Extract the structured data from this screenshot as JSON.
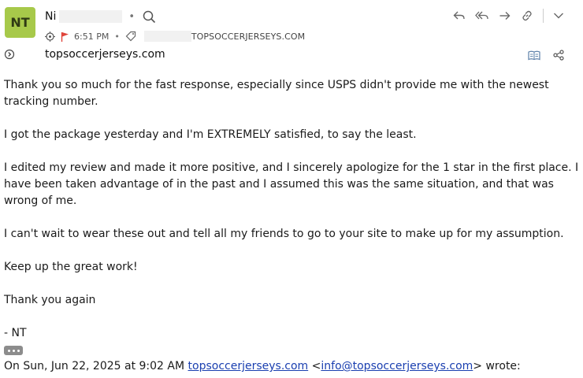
{
  "sender": {
    "initials": "NT",
    "name": "Ni",
    "time": "6:51 PM",
    "domain_label": "TOPSOCCERJERSEYS.COM"
  },
  "subject": "topsoccerjerseys.com",
  "body": {
    "paragraphs": [
      "Thank you so much for the fast response, especially since USPS didn't provide me with the newest tracking number.",
      "I got the package yesterday and I'm EXTREMELY satisfied, to say the least.",
      "I edited my review and made it more positive, and I sincerely apologize for the 1 star in the first place. I have been taken advantage of in the past and I assumed this was the same situation, and that was wrong of me.",
      "I can't wait to wear these out and tell all my friends to go to your site to make up for my assumption.",
      "Keep up the great work!",
      "Thank you again",
      "- NT"
    ],
    "quote": {
      "prefix": "On Sun, Jun 22, 2025 at 9:02 AM ",
      "sender_link": "topsoccerjerseys.com",
      "open": " <",
      "email_link": "info@topsoccerjerseys.com",
      "suffix": "> wrote:"
    }
  },
  "colors": {
    "avatar": "#a7c94a",
    "flag": "#e0443b",
    "link": "#1a3fb0"
  },
  "icons": [
    "search-icon",
    "target-icon",
    "flag-icon",
    "tag-icon",
    "reply-icon",
    "reply-all-icon",
    "forward-icon",
    "link-icon",
    "chevron-down-icon",
    "expand-icon",
    "reader-icon",
    "share-icon"
  ]
}
